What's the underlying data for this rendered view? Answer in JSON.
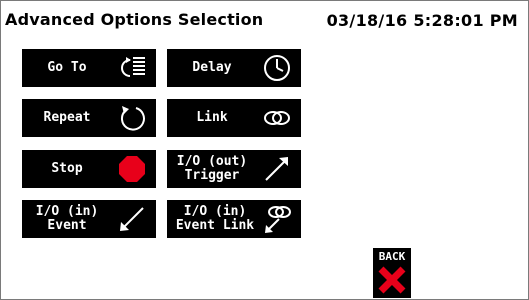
{
  "header": {
    "title": "Advanced Options Selection",
    "datetime": "03/18/16 5:28:01 PM"
  },
  "options": {
    "goto": {
      "label": "Go To",
      "icon": "goto-list-icon"
    },
    "delay": {
      "label": "Delay",
      "icon": "clock-icon"
    },
    "repeat": {
      "label": "Repeat",
      "icon": "repeat-icon"
    },
    "link": {
      "label": "Link",
      "icon": "link-icon"
    },
    "stop": {
      "label": "Stop",
      "icon": "stop-sign-icon"
    },
    "io_out_trigger": {
      "line1": "I/O (out)",
      "line2": "Trigger",
      "icon": "arrow-up-right-icon"
    },
    "io_in_event": {
      "line1": "I/O (in)",
      "line2": "Event",
      "icon": "arrow-down-left-icon"
    },
    "io_in_event_link": {
      "line1": "I/O (in)",
      "line2": "Event Link",
      "icon": "link-arrow-icon"
    }
  },
  "back": {
    "label": "BACK",
    "icon": "red-x-icon"
  },
  "colors": {
    "tile_bg": "#000000",
    "tile_text": "#ffffff",
    "stop_red": "#e8001a",
    "back_x": "#e8001a"
  }
}
